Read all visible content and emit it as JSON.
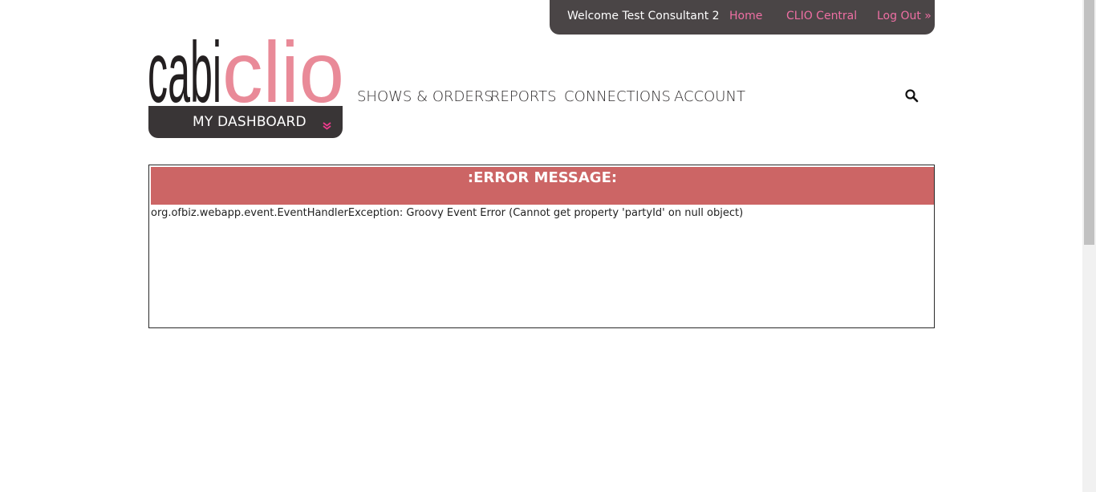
{
  "user_bar": {
    "welcome": "Welcome Test Consultant 2",
    "links": [
      "Home",
      "CLIO Central",
      "Log Out »"
    ]
  },
  "logo": {
    "part1": "cabi",
    "part2": "clio"
  },
  "dashboard": {
    "label": "MY DASHBOARD",
    "icon": "double-chevron-down-icon"
  },
  "nav": {
    "items": [
      "SHOWS & ORDERS",
      "REPORTS",
      "CONNECTIONS",
      "ACCOUNT"
    ]
  },
  "search": {
    "icon": "search-icon"
  },
  "error": {
    "title": ":ERROR MESSAGE:",
    "message": "org.ofbiz.webapp.event.EventHandlerException: Groovy Event Error (Cannot get property 'partyId' on null object)"
  },
  "colors": {
    "brand_dark": "#393536",
    "brand_pink": "#ee6fa3",
    "logo_pink": "#e98a98",
    "error_header": "#cc6565"
  }
}
